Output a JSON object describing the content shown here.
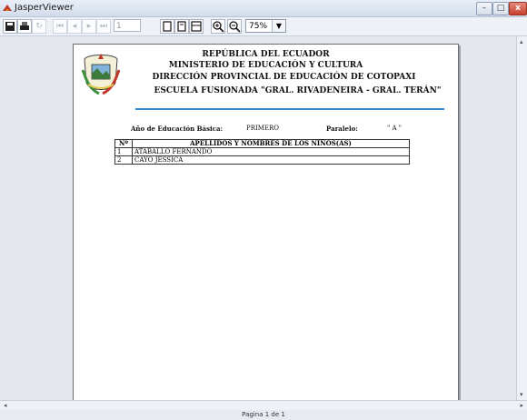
{
  "window": {
    "title": "JasperViewer",
    "buttons": {
      "minimize": "–",
      "maximize": "□",
      "close": "x"
    }
  },
  "toolbar": {
    "page_number": "1",
    "zoom_value": "75%",
    "icons": [
      "save-icon",
      "print-icon",
      "reload-icon",
      "first-page-icon",
      "prev-page-icon",
      "next-page-icon",
      "last-page-icon",
      "actual-size-icon",
      "fit-page-icon",
      "fit-width-icon",
      "zoom-in-icon",
      "zoom-out-icon"
    ]
  },
  "report": {
    "header_lines": [
      "REPÚBLICA DEL ECUADOR",
      "MINISTERIO DE EDUCACIÓN Y CULTURA",
      "DIRECCIÓN PROVINCIAL DE EDUCACIÓN DE COTOPAXI",
      "ESCUELA FUSIONADA  \"GRAL. RIVADENEIRA - GRAL. TERÁN\""
    ],
    "grade_label": "Año de Educación Básica:",
    "grade_value": "PRIMERO",
    "parallel_label": "Paralelo:",
    "parallel_value": "\" A \"",
    "table": {
      "col_num": "Nº",
      "col_name": "APELLIDOS Y NOMBRES DE LOS NIÑOS(AS)",
      "rows": [
        {
          "num": "1",
          "name": "ATABALLO FERNANDO"
        },
        {
          "num": "2",
          "name": "CAYO JESSICA"
        }
      ]
    }
  },
  "status": {
    "page_text": "Pagina 1 de 1"
  }
}
